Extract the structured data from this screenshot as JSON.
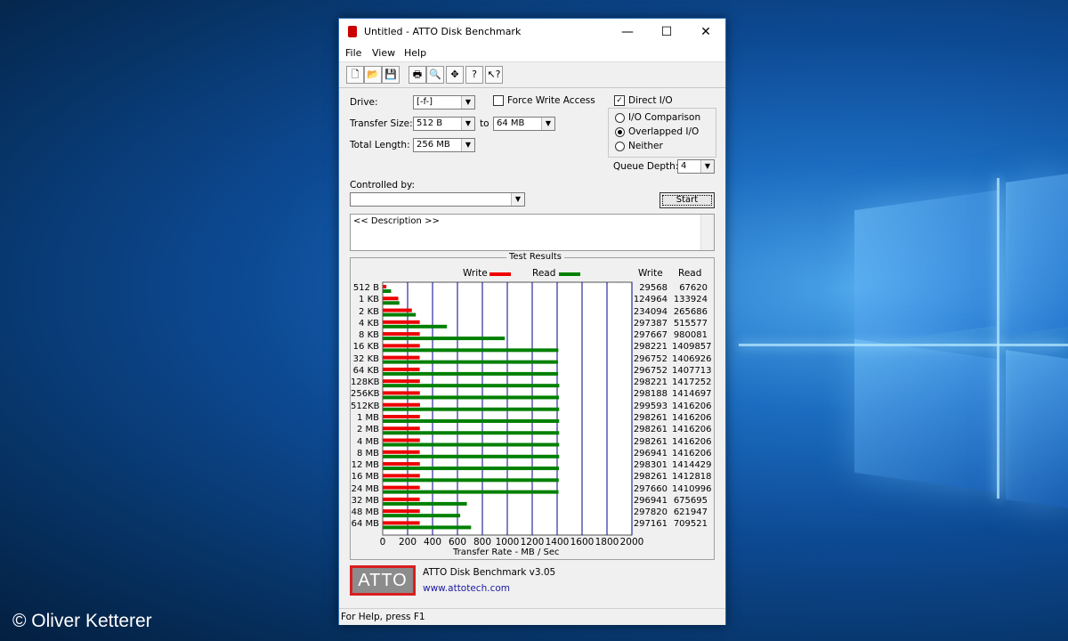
{
  "window": {
    "title": "Untitled - ATTO Disk Benchmark",
    "min_glyph": "—",
    "max_glyph": "☐",
    "close_glyph": "✕"
  },
  "menu": [
    "File",
    "View",
    "Help"
  ],
  "toolbar": {
    "buttons": [
      "new-icon",
      "open-icon",
      "save-icon",
      "print-icon",
      "print-preview-icon",
      "move-icon",
      "help-icon",
      "context-help-icon"
    ]
  },
  "settings": {
    "drive_label": "Drive:",
    "drive_value": "[-f-]",
    "force_write_label": "Force Write Access",
    "force_write_checked": false,
    "direct_io_label": "Direct I/O",
    "direct_io_checked": true,
    "transfer_size_label": "Transfer Size:",
    "transfer_from": "512 B",
    "to_label": "to",
    "transfer_to": "64 MB",
    "total_length_label": "Total Length:",
    "total_length": "256 MB",
    "io_options": [
      "I/O Comparison",
      "Overlapped I/O",
      "Neither"
    ],
    "io_selected": 1,
    "queue_depth_label": "Queue Depth:",
    "queue_depth": "4",
    "controlled_by_label": "Controlled by:",
    "controlled_by_value": "",
    "start_label": "Start",
    "description": "<< Description >>"
  },
  "results": {
    "title": "Test Results",
    "legend_write": "Write",
    "legend_read": "Read",
    "col_write": "Write",
    "col_read": "Read",
    "xlabel": "Transfer Rate - MB / Sec"
  },
  "colors": {
    "write": "#ee0000",
    "read": "#008000",
    "grid": "#00008b"
  },
  "chart_data": {
    "type": "bar",
    "orientation": "horizontal",
    "categories": [
      "512 B",
      "1 KB",
      "2 KB",
      "4 KB",
      "8 KB",
      "16 KB",
      "32 KB",
      "64 KB",
      "128KB",
      "256KB",
      "512KB",
      "1 MB",
      "2 MB",
      "4 MB",
      "8 MB",
      "12 MB",
      "16 MB",
      "24 MB",
      "32 MB",
      "48 MB",
      "64 MB"
    ],
    "series": [
      {
        "name": "Write",
        "values": [
          29568,
          124964,
          234094,
          297387,
          297667,
          298221,
          296752,
          296752,
          298221,
          298188,
          299593,
          298261,
          298261,
          298261,
          296941,
          298301,
          298261,
          297660,
          296941,
          297820,
          297161
        ]
      },
      {
        "name": "Read",
        "values": [
          67620,
          133924,
          265686,
          515577,
          980081,
          1409857,
          1406926,
          1407713,
          1417252,
          1414697,
          1416206,
          1416206,
          1416206,
          1416206,
          1416206,
          1414429,
          1412818,
          1410996,
          675695,
          621947,
          709521
        ]
      }
    ],
    "xticks": [
      "0",
      "200",
      "400",
      "600",
      "800",
      "1000",
      "1200",
      "1400",
      "1600",
      "1800",
      "2000"
    ],
    "xlim": [
      0,
      2000
    ],
    "xlabel": "Transfer Rate - MB / Sec",
    "grid": true,
    "legend": "top"
  },
  "footer": {
    "logo_text": "ATTO",
    "product": "ATTO Disk Benchmark v3.05",
    "url": "www.attotech.com"
  },
  "status": "For Help, press F1",
  "watermark": "© Oliver Ketterer"
}
